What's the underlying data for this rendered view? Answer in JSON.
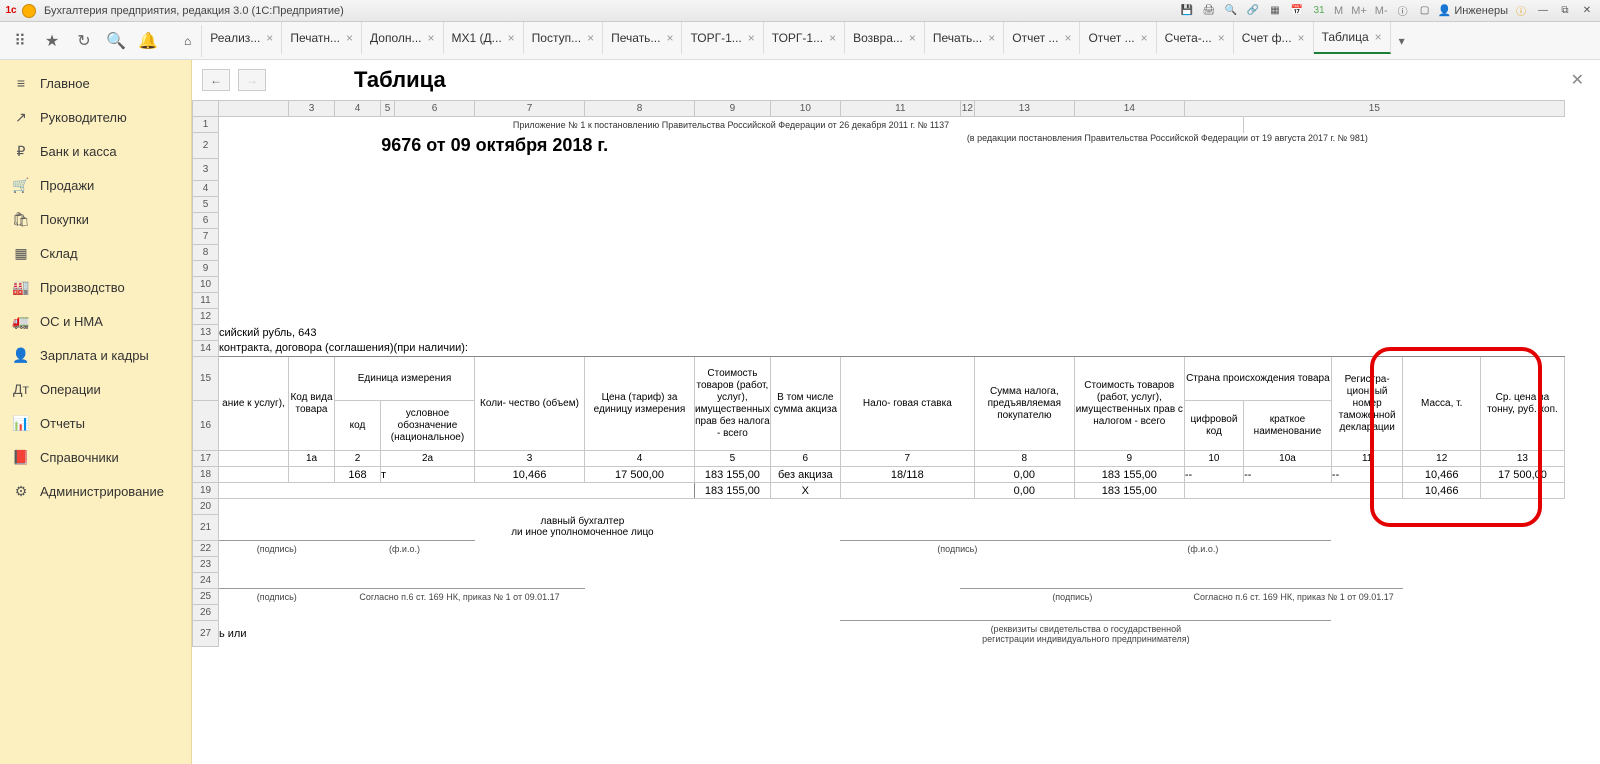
{
  "titlebar": {
    "title": "Бухгалтерия предприятия, редакция 3.0  (1С:Предприятие)",
    "user": "Инженеры"
  },
  "tabs": [
    {
      "label": "Реализ..."
    },
    {
      "label": "Печатн..."
    },
    {
      "label": "Дополн..."
    },
    {
      "label": "МХ1 (Д..."
    },
    {
      "label": "Поступ..."
    },
    {
      "label": "Печать..."
    },
    {
      "label": "ТОРГ-1..."
    },
    {
      "label": "ТОРГ-1..."
    },
    {
      "label": "Возвра..."
    },
    {
      "label": "Печать..."
    },
    {
      "label": "Отчет ..."
    },
    {
      "label": "Отчет ..."
    },
    {
      "label": "Счета-..."
    },
    {
      "label": "Счет ф..."
    },
    {
      "label": "Таблица",
      "active": true
    }
  ],
  "sidebar": [
    {
      "icon": "≡",
      "label": "Главное"
    },
    {
      "icon": "↗",
      "label": "Руководителю"
    },
    {
      "icon": "₽",
      "label": "Банк и касса"
    },
    {
      "icon": "🛒",
      "label": "Продажи"
    },
    {
      "icon": "🛍",
      "label": "Покупки"
    },
    {
      "icon": "▦",
      "label": "Склад"
    },
    {
      "icon": "🏭",
      "label": "Производство"
    },
    {
      "icon": "🚛",
      "label": "ОС и НМА"
    },
    {
      "icon": "👤",
      "label": "Зарплата и кадры"
    },
    {
      "icon": "Дт",
      "label": "Операции"
    },
    {
      "icon": "📊",
      "label": "Отчеты"
    },
    {
      "icon": "📕",
      "label": "Справочники"
    },
    {
      "icon": "⚙",
      "label": "Администрирование"
    }
  ],
  "content": {
    "title": "Таблица",
    "doc_title": "9676 от 09 октября 2018 г.",
    "note1": "Приложение № 1 к постановлению Правительства Российской Федерации от 26 декабря 2011 г. № 1137",
    "note2": "(в редакции постановления Правительства Российской Федерации от 19 августа 2017 г. № 981)",
    "col_numbers": [
      "3",
      "4",
      "5",
      "6",
      "7",
      "8",
      "9",
      "10",
      "11",
      "12",
      "13",
      "14",
      "15"
    ],
    "row13": "сийский рубль, 643",
    "row14": "контракта, договора (соглашения)(при наличии):",
    "headers": {
      "h1": "ание\nк услуг),",
      "h2": "Код\nвида\nтовара",
      "h3": "Единица\nизмерения",
      "h4": "код",
      "h5": "условное\nобозначение\n(национальное)",
      "h6": "Коли-\nчество\n(объем)",
      "h7": "Цена\n(тариф) за\nединицу\nизмерения",
      "h8": "Стоимость\nтоваров (работ,\nуслуг),\nимущественных\nправ без налога -\nвсего",
      "h9": "В том\nчисле\nсумма\nакциза",
      "h10": "Нало-\nговая\nставка",
      "h11": "Сумма налога,\nпредъявляемая\nпокупателю",
      "h12": "Стоимость товаров\n(работ, услуг),\nимущественных\nправ с налогом -\nвсего",
      "h13": "Страна\nпроисхождения товара",
      "h14": "цифровой\nкод",
      "h15": "краткое\nнаименование",
      "h16": "Регистра-\nционный\nномер\nтаможенной\nдекларации",
      "h17": "Масса, т.",
      "h18": "Ср. цена за\nтонну, руб.\nкоп."
    },
    "subcols": [
      "1а",
      "2",
      "2а",
      "3",
      "4",
      "5",
      "6",
      "7",
      "8",
      "9",
      "10",
      "10а",
      "11",
      "12",
      "13"
    ],
    "data_rows": [
      {
        "c2": "168",
        "c2a": "т",
        "c3": "10,466",
        "c4": "17 500,00",
        "c5": "183 155,00",
        "c6": "без акциза",
        "c7": "18/118",
        "c8": "0,00",
        "c9": "183 155,00",
        "c10": "--",
        "c10a": "--",
        "c11": "--",
        "c12": "10,466",
        "c13": "17 500,00"
      },
      {
        "c5": "183 155,00",
        "c6": "Х",
        "c8": "0,00",
        "c9": "183 155,00",
        "c12": "10,466"
      }
    ],
    "signatures": {
      "main_title": "лавный бухгалтер\nли иное уполномоченное лицо",
      "podpis": "(подпись)",
      "fio": "(ф.и.о.)",
      "soglasno": "Согласно п.6 ст. 169 НК, приказ  № 1 от 09.01.17",
      "rekvizit": "(реквизиты свидетельства о государственной\nрегистрации индивидуального предпринимателя)",
      "ili": "ь или"
    }
  }
}
